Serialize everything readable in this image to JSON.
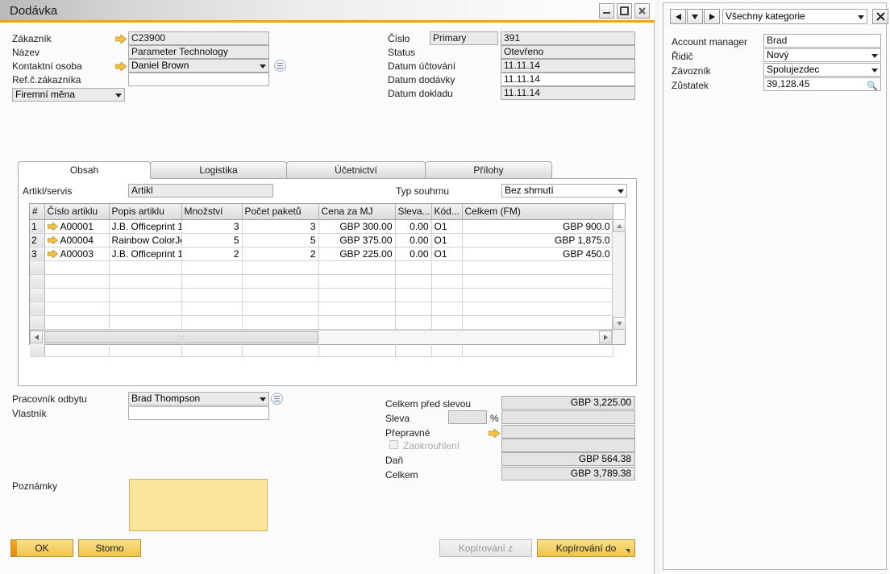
{
  "window": {
    "title": "Dodávka",
    "buttons": {
      "minimize": "minimize-icon",
      "maximize": "maximize-icon",
      "close": "close-icon"
    }
  },
  "header_left": {
    "customer_label": "Zákazník",
    "customer_value": "C23900",
    "name_label": "Název",
    "name_value": "Parameter Technology",
    "contact_label": "Kontaktní osoba",
    "contact_value": "Daniel Brown",
    "refno_label": "Ref.č.zákazníka",
    "refno_value": "",
    "currency_value": "Firemní měna"
  },
  "header_right": {
    "number_label": "Číslo",
    "number_series": "Primary",
    "number_value": "391",
    "status_label": "Status",
    "status_value": "Otevřeno",
    "posting_date_label": "Datum účtování",
    "posting_date_value": "11.11.14",
    "delivery_date_label": "Datum dodávky",
    "delivery_date_value": "11.11.14",
    "document_date_label": "Datum dokladu",
    "document_date_value": "11.11.14"
  },
  "tabs": [
    {
      "label": "Obsah",
      "active": true
    },
    {
      "label": "Logistika",
      "active": false
    },
    {
      "label": "Účetnictví",
      "active": false
    },
    {
      "label": "Přílohy",
      "active": false
    }
  ],
  "content_tab": {
    "item_service_label": "Artikl/servis",
    "item_service_value": "Artikl",
    "summary_type_label": "Typ souhrnu",
    "summary_type_value": "Bez shrnutí",
    "grid": {
      "columns": [
        "#",
        "Číslo artiklu",
        "Popis artiklu",
        "Množství",
        "Počet paketů",
        "Cena za MJ",
        "Sleva...",
        "Kód...",
        "Celkem (FM)"
      ],
      "rows": [
        {
          "num": "1",
          "item_no": "A00001",
          "description": "J.B. Officeprint 1",
          "quantity": "3",
          "packages": "3",
          "unit_price": "GBP 300.00",
          "discount": "0.00",
          "code": "O1",
          "total": "GBP 900.0"
        },
        {
          "num": "2",
          "item_no": "A00004",
          "description": "Rainbow ColorJe",
          "quantity": "5",
          "packages": "5",
          "unit_price": "GBP 375.00",
          "discount": "0.00",
          "code": "O1",
          "total": "GBP 1,875.0"
        },
        {
          "num": "3",
          "item_no": "A00003",
          "description": "J.B. Officeprint 1",
          "quantity": "2",
          "packages": "2",
          "unit_price": "GBP 225.00",
          "discount": "0.00",
          "code": "O1",
          "total": "GBP 450.0"
        }
      ],
      "empty_row_count": 7
    }
  },
  "footer_left": {
    "salesperson_label": "Pracovník odbytu",
    "salesperson_value": "Brad Thompson",
    "owner_label": "Vlastník",
    "owner_value": "",
    "notes_label": "Poznámky",
    "notes_value": ""
  },
  "totals": {
    "before_discount_label": "Celkem před slevou",
    "before_discount_value": "GBP 3,225.00",
    "discount_label": "Sleva",
    "discount_value": "",
    "percent_sign": "%",
    "discount_amount_value": "",
    "freight_label": "Přepravné",
    "freight_value": "",
    "rounding_label": "Zaokrouhlení",
    "rounding_value": "",
    "tax_label": "Daň",
    "tax_value": "GBP 564.38",
    "total_label": "Celkem",
    "total_value": "GBP 3,789.38"
  },
  "actions": {
    "ok": "OK",
    "cancel": "Storno",
    "copy_from": "Kopírování z",
    "copy_to": "Kopírování do"
  },
  "sidebar": {
    "category_selector": "Všechny kategorie",
    "close_label": "✕",
    "fields": [
      {
        "label": "Account manager",
        "value": "Brad",
        "type": "text"
      },
      {
        "label": "Řidič",
        "value": "Nový",
        "type": "combo"
      },
      {
        "label": "Závozník",
        "value": "Spolujezdec",
        "type": "combo"
      },
      {
        "label": "Zůstatek",
        "value": "39,128.45",
        "type": "search"
      }
    ]
  },
  "colors": {
    "accent": "#f0a500",
    "button": "#efc44a",
    "notes_bg": "#fae59b",
    "field_bg": "#eaeaea"
  }
}
